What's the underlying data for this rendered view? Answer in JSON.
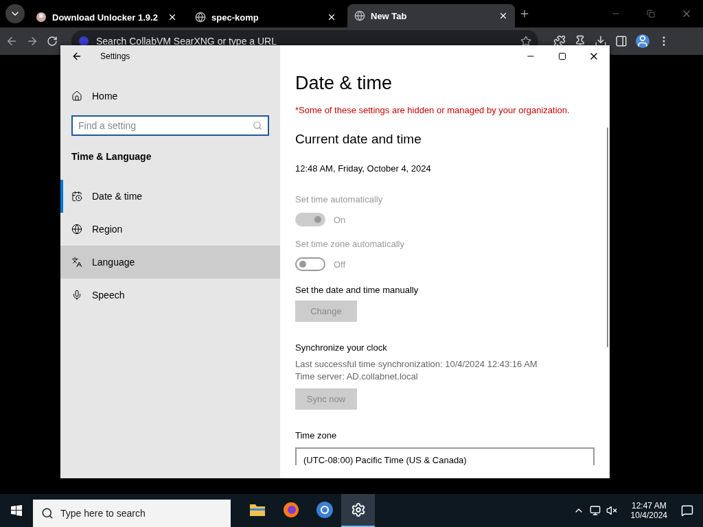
{
  "browser": {
    "tabs": [
      {
        "title": "Download Unlocker 1.9.2",
        "selected": false
      },
      {
        "title": "spec-komp",
        "selected": false
      },
      {
        "title": "New Tab",
        "selected": true
      }
    ],
    "address_placeholder": "Search CollabVM SearXNG or type a URL"
  },
  "settings": {
    "title": "Settings",
    "home": "Home",
    "search_placeholder": "Find a setting",
    "section": "Time & Language",
    "nav": [
      {
        "label": "Date & time",
        "selected": true,
        "hovered": false
      },
      {
        "label": "Region",
        "selected": false,
        "hovered": false
      },
      {
        "label": "Language",
        "selected": false,
        "hovered": true
      },
      {
        "label": "Speech",
        "selected": false,
        "hovered": false
      }
    ],
    "heading": "Date & time",
    "warning": "*Some of these settings are hidden or managed by your organization.",
    "subheading": "Current date and time",
    "current": "12:48 AM, Friday, October 4, 2024",
    "toggles": [
      {
        "label": "Set time automatically",
        "on": true,
        "disabled": true,
        "state_text": "On"
      },
      {
        "label": "Set time zone automatically",
        "on": false,
        "disabled": true,
        "state_text": "Off"
      }
    ],
    "manual_label": "Set the date and time manually",
    "change_button": {
      "label": "Change",
      "disabled": true
    },
    "sync_heading": "Synchronize your clock",
    "sync_lines": [
      "Last successful time synchronization: 10/4/2024 12:43:16 AM",
      "Time server: AD.collabnet.local"
    ],
    "sync_button": {
      "label": "Sync now",
      "disabled": true
    },
    "timezone_label": "Time zone",
    "timezone_value": "(UTC-08:00) Pacific Time (US & Canada)"
  },
  "taskbar": {
    "search_placeholder": "Type here to search",
    "apps": [
      {
        "kind": "folder",
        "active": false
      },
      {
        "kind": "firefox",
        "active": false
      },
      {
        "kind": "chrome",
        "active": false
      },
      {
        "kind": "settings",
        "active": true
      }
    ],
    "time": "12:47 AM",
    "date": "10/4/2024"
  }
}
